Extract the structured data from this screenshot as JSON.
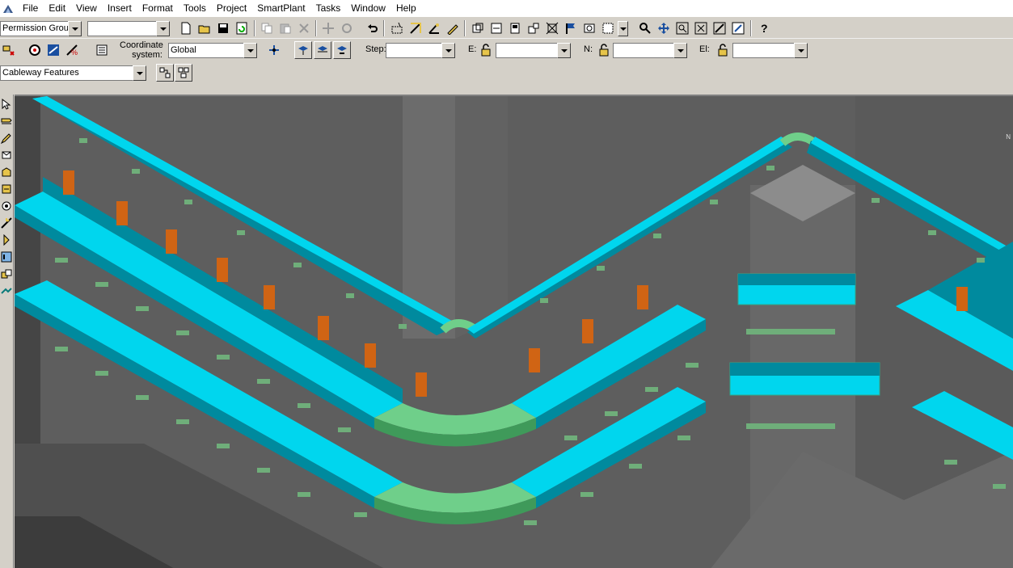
{
  "menu": {
    "items": [
      "File",
      "Edit",
      "View",
      "Insert",
      "Format",
      "Tools",
      "Project",
      "SmartPlant",
      "Tasks",
      "Window",
      "Help"
    ]
  },
  "toolbar1": {
    "permission_group_label": "Permission Group",
    "permission_group_value": ""
  },
  "toolbar2": {
    "coordinate_label": "Coordinate\nsystem:",
    "coordinate_value": "Global",
    "step_label": "Step:",
    "step_value": "",
    "e_label": "E:",
    "e_value": "",
    "n_label": "N:",
    "n_value": "",
    "el_label": "El:",
    "el_value": ""
  },
  "toolbar3": {
    "feature_value": "Cableway Features"
  },
  "viewport": {
    "axis_label": "N",
    "colors": {
      "background": "#5a5a5a",
      "tray_top": "#00d6ee",
      "tray_side": "#008a9e",
      "bend": "#6fcf8a",
      "support": "#6fae7a",
      "steel": "#d06414"
    }
  }
}
